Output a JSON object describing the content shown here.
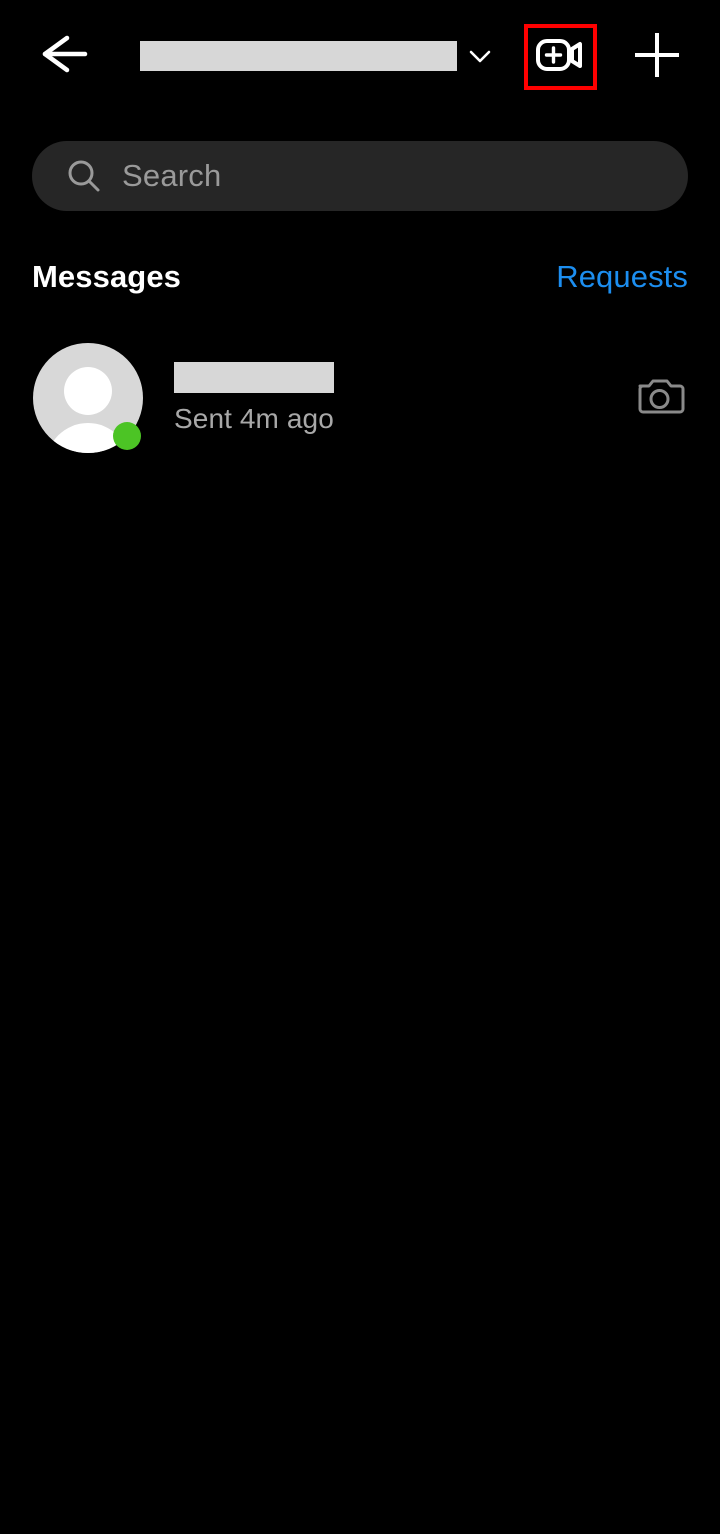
{
  "app": {
    "name": "Instagram Direct",
    "background_color": "#000000"
  },
  "colors": {
    "background": "#000000",
    "search_field": "#262626",
    "accent_blue": "#1c8ef0",
    "online_green": "#4cc425",
    "highlight_red": "#ff0000",
    "redaction_gray": "#d7d7d7",
    "muted_text": "#a8a8a8",
    "placeholder_text": "#9a9a9a"
  },
  "topbar": {
    "back_icon": "arrow-left-icon",
    "account_name": "",
    "account_name_redacted": true,
    "chevron_icon": "chevron-down-icon",
    "video_call_icon": "video-call-add-icon",
    "video_call_highlighted": true,
    "new_message_icon": "plus-icon"
  },
  "search": {
    "icon": "search-icon",
    "value": "",
    "placeholder": "Search"
  },
  "section": {
    "title": "Messages",
    "action_label": "Requests"
  },
  "conversations": [
    {
      "avatar_icon": "default-avatar-icon",
      "name": "",
      "name_redacted": true,
      "online": true,
      "status": "Sent 4m ago",
      "trailing_icon": "camera-icon"
    }
  ]
}
